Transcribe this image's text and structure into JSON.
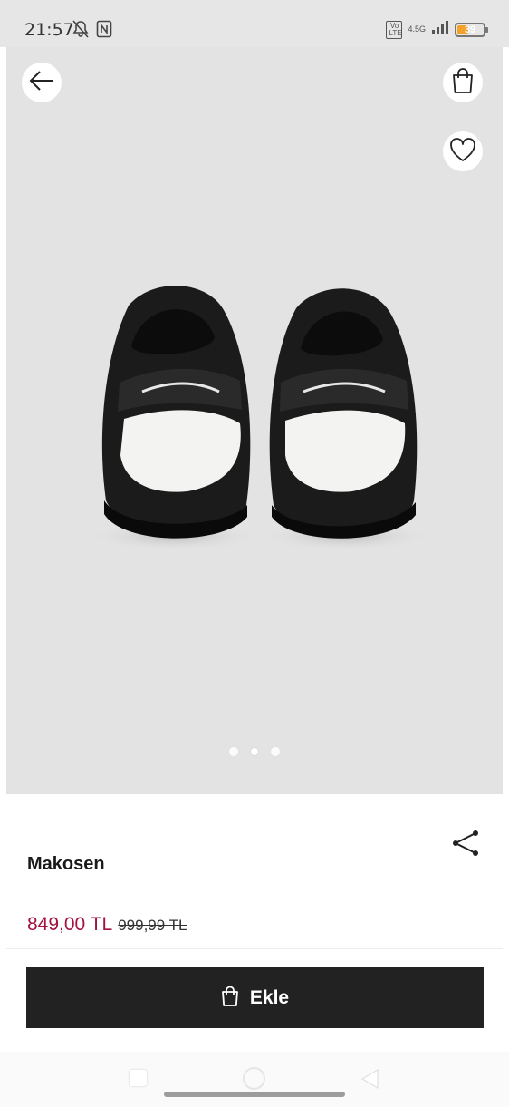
{
  "status_bar": {
    "time": "21:57",
    "network": "4.5G",
    "volte": "Vo LTE",
    "battery_level": "39",
    "battery_fraction": 0.39,
    "icons": [
      "bell-off-icon",
      "nfc-icon",
      "signal-icon",
      "battery-icon"
    ]
  },
  "gallery": {
    "image_alt": "Makosen",
    "page_count": 3,
    "current_page": 2
  },
  "header_actions": {
    "back_icon": "arrow-left-icon",
    "bag_icon": "shopping-bag-icon",
    "favorite_icon": "heart-icon"
  },
  "product": {
    "name": "Makosen",
    "price": "849,00 TL",
    "old_price": "999,99 TL",
    "share_icon": "share-icon"
  },
  "add_button": {
    "label": "Ekle",
    "icon": "shopping-bag-icon"
  },
  "colors": {
    "price_accent": "#a3133f",
    "button_bg": "#222222",
    "image_bg": "#e3e3e4"
  }
}
